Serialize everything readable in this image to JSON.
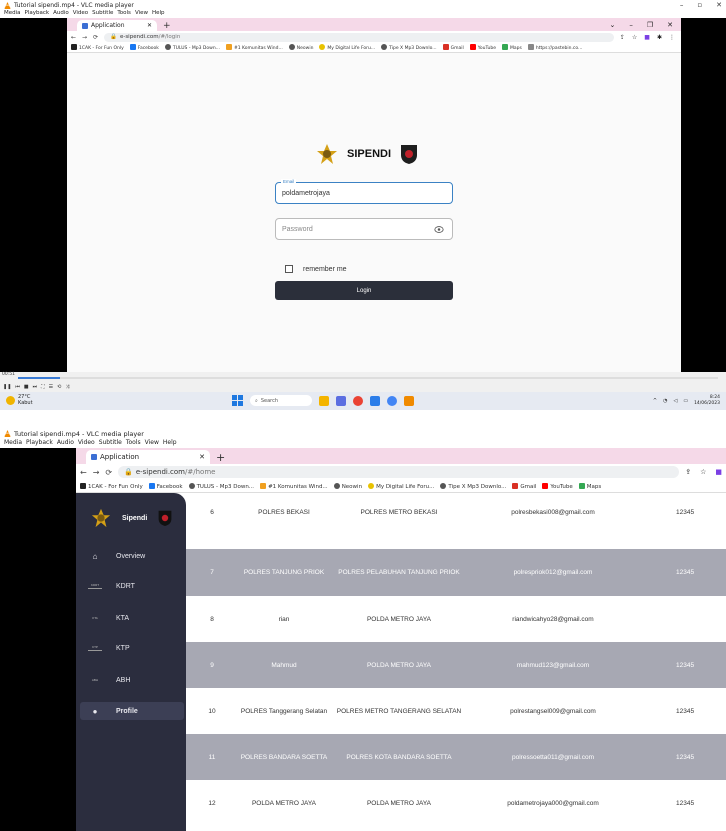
{
  "vlc": {
    "title": "Tutorial sipendi.mp4 - VLC media player",
    "menu": [
      "Media",
      "Playback",
      "Audio",
      "Video",
      "Subtitle",
      "Tools",
      "View",
      "Help"
    ],
    "elapsed": "00:51",
    "progress_percent": 6
  },
  "browser1": {
    "tab_label": "Application",
    "url_host": "e-sipendi.com",
    "url_path": "/#/login"
  },
  "browser2": {
    "tab_label": "Application",
    "url_host": "e-sipendi.com",
    "url_path": "/#/home"
  },
  "bookmarks": [
    "1CAK - For Fun Only",
    "Facebook",
    "TULUS - Mp3 Down...",
    "#1 Komunitas Wind...",
    "Neowin",
    "My Digital Life Foru...",
    "Tipe X Mp3 Downlo...",
    "Gmail",
    "YouTube",
    "Maps",
    "https://pastebin.co..."
  ],
  "login": {
    "brand": "SIPENDI",
    "email_label": "Email",
    "email_value": "poldametrojaya",
    "password_placeholder": "Password",
    "remember_label": "remember me",
    "login_button": "Login"
  },
  "taskbar": {
    "temperature": "27°C",
    "weather": "Kabut",
    "search_placeholder": "Search",
    "time": "8:24",
    "date": "14/06/2023"
  },
  "dashboard": {
    "brand": "Sipendi",
    "nav": [
      {
        "label": "Overview",
        "tag": ""
      },
      {
        "label": "KDRT",
        "tag": "KDRT"
      },
      {
        "label": "KTA",
        "tag": "KTA"
      },
      {
        "label": "KTP",
        "tag": "KTP"
      },
      {
        "label": "ABH",
        "tag": "ABH"
      },
      {
        "label": "Profile",
        "tag": ""
      }
    ],
    "rows": [
      {
        "no": "6",
        "name": "POLRES BEKASI",
        "unit": "POLRES METRO BEKASI",
        "email": "polresbekasi008@gmail.com",
        "code": "12345"
      },
      {
        "no": "7",
        "name": "POLRES TANJUNG PRIOK",
        "unit": "POLRES PELABUHAN TANJUNG PRIOK",
        "email": "polrespriok012@gmail.com",
        "code": "12345"
      },
      {
        "no": "8",
        "name": "rian",
        "unit": "POLDA METRO JAYA",
        "email": "riandwicahyo28@gmail.com",
        "code": ""
      },
      {
        "no": "9",
        "name": "Mahmud",
        "unit": "POLDA METRO JAYA",
        "email": "mahmud123@gmail.com",
        "code": "12345"
      },
      {
        "no": "10",
        "name": "POLRES Tanggerang Selatan",
        "unit": "POLRES METRO TANGERANG SELATAN",
        "email": "polrestangsel009@gmail.com",
        "code": "12345"
      },
      {
        "no": "11",
        "name": "POLRES BANDARA SOETTA",
        "unit": "POLRES KOTA BANDARA SOETTA",
        "email": "polressoetta011@gmail.com",
        "code": "12345"
      },
      {
        "no": "12",
        "name": "POLDA METRO JAYA",
        "unit": "POLDA METRO JAYA",
        "email": "poldametrojaya000@gmail.com",
        "code": "12345"
      }
    ]
  },
  "colors": {
    "tab_bar": "#f5d9e8",
    "sidebar": "#2b2d3e",
    "alt_row": "#a7a8b3",
    "login_button": "#2b2f3a",
    "focus": "#3b82c4"
  }
}
